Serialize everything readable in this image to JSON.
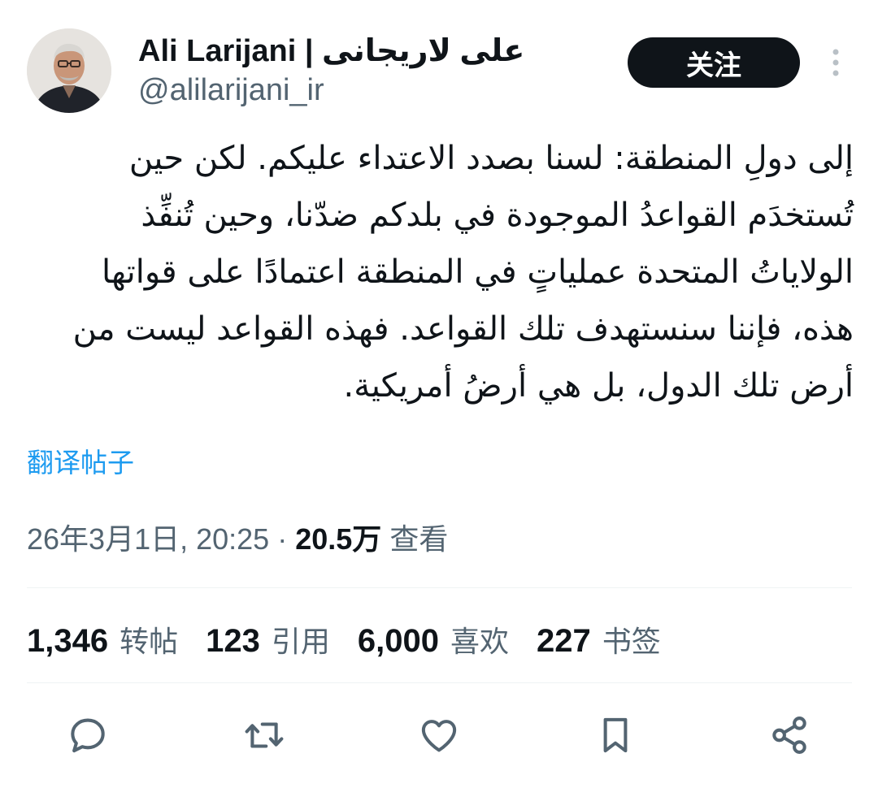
{
  "author": {
    "display_name": "Ali Larijani | علی لاریجانی",
    "handle": "@alilarijani_ir",
    "avatar_icon": "profile-photo"
  },
  "follow_button": {
    "label": "关注"
  },
  "more_button": {
    "icon": "more-vertical-icon"
  },
  "post": {
    "text": "إلى دولِ المنطقة: لسنا بصدد الاعتداء عليكم. لكن حين تُستخدَم القواعدُ الموجودة في بلدكم ضدّنا، وحين تُنفِّذ الولاياتُ المتحدة عملياتٍ في المنطقة اعتمادًا على قواتها هذه، فإننا سنستهدف تلك القواعد. فهذه القواعد ليست من أرض تلك الدول، بل هي أرضُ أمريكية."
  },
  "translate_link": {
    "label": "翻译帖子"
  },
  "meta": {
    "timestamp": "26年3月1日, 20:25",
    "separator": "·",
    "views_count": "20.5万",
    "views_label": "查看"
  },
  "stats": [
    {
      "value": "1,346",
      "label": "转帖"
    },
    {
      "value": "123",
      "label": "引用"
    },
    {
      "value": "6,000",
      "label": "喜欢"
    },
    {
      "value": "227",
      "label": "书签"
    }
  ],
  "actions": [
    "reply-icon",
    "repost-icon",
    "like-icon",
    "bookmark-icon",
    "share-icon"
  ],
  "colors": {
    "text_primary": "#0f1419",
    "text_secondary": "#536471",
    "link": "#1d9bf0",
    "button_bg": "#0f1419",
    "divider": "#eff3f4"
  }
}
